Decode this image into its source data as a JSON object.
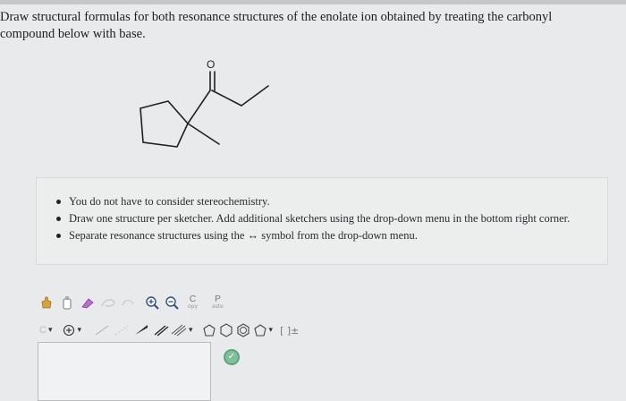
{
  "question": {
    "line1": "Draw structural formulas for both resonance structures of the enolate ion obtained by treating the carbonyl",
    "line2": "compound below with base."
  },
  "molecule": {
    "atom_label": "O"
  },
  "instructions": {
    "items": [
      "You do not have to consider stereochemistry.",
      "Draw one structure per sketcher. Add additional sketchers using the drop-down menu in the bottom right corner.",
      "Separate resonance structures using the ↔ symbol from the drop-down menu."
    ]
  },
  "toolbar": {
    "copy_label": "C",
    "copy_sub": "opy",
    "paste_label": "P",
    "paste_sub": "aste",
    "dropdown_glyph": "▾",
    "brackets_label": "[ ]±"
  },
  "sketcher": {
    "check_glyph": "✓"
  },
  "colors": {
    "page_bg": "#e9eaec",
    "panel_bg": "#eceded",
    "check_green": "#7fbf9a",
    "icon_blue": "#3d6fb5",
    "icon_red": "#c2453d"
  }
}
